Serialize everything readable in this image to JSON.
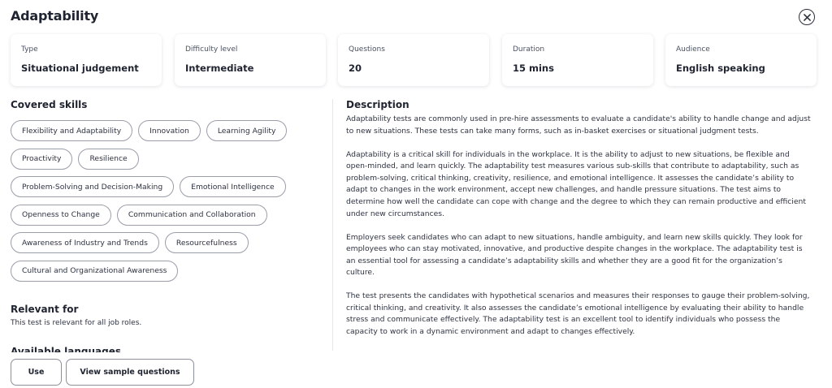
{
  "modal": {
    "title": "Adaptability"
  },
  "info_cards": [
    {
      "label": "Type",
      "value": "Situational judgement"
    },
    {
      "label": "Difficulty level",
      "value": "Intermediate"
    },
    {
      "label": "Questions",
      "value": "20"
    },
    {
      "label": "Duration",
      "value": "15 mins"
    },
    {
      "label": "Audience",
      "value": "English speaking"
    }
  ],
  "skills": {
    "heading": "Covered skills",
    "items": [
      "Flexibility and Adaptability",
      "Innovation",
      "Learning Agility",
      "Proactivity",
      "Resilience",
      "Problem-Solving and Decision-Making",
      "Emotional Intelligence",
      "Openness to Change",
      "Communication and Collaboration",
      "Awareness of Industry and Trends",
      "Resourcefulness",
      "Cultural and Organizational Awareness"
    ]
  },
  "relevant": {
    "heading": "Relevant for",
    "text": "This test is relevant for all job roles."
  },
  "languages": {
    "heading": "Available languages"
  },
  "description": {
    "heading": "Description",
    "paragraphs": [
      "Adaptability tests are commonly used in pre-hire assessments to evaluate a candidate's ability to handle change and adjust to new situations. These tests can take many forms, such as in-basket exercises or situational judgment tests.",
      "Adaptability is a critical skill for individuals in the workplace. It is the ability to adjust to new situations, be flexible and open-minded, and learn quickly. The adaptability test measures various sub-skills that contribute to adaptability, such as problem-solving, critical thinking, creativity, resilience, and emotional intelligence. It assesses the candidate’s ability to adapt to changes in the work environment, accept new challenges, and handle pressure situations. The test aims to determine how well the candidate can cope with change and the degree to which they can remain productive and efficient under new circumstances.",
      "Employers seek candidates who can adapt to new situations, handle ambiguity, and learn new skills quickly. They look for employees who can stay motivated, innovative, and productive despite changes in the workplace. The adaptability test is an essential tool for assessing a candidate’s adaptability skills and whether they are a good fit for the organization’s culture.",
      "The test presents the candidates with hypothetical scenarios and measures their responses to gauge their problem-solving, critical thinking, and creativity. It also assesses the candidate’s emotional intelligence by evaluating their ability to handle stress and communicate effectively. The adaptability test is an excellent tool to identify individuals who possess the capacity to work in a dynamic environment and adapt to changes effectively."
    ]
  },
  "actions": {
    "use_label": "Use",
    "sample_label": "View sample questions"
  },
  "icons": {
    "close": "close-circle-icon"
  }
}
